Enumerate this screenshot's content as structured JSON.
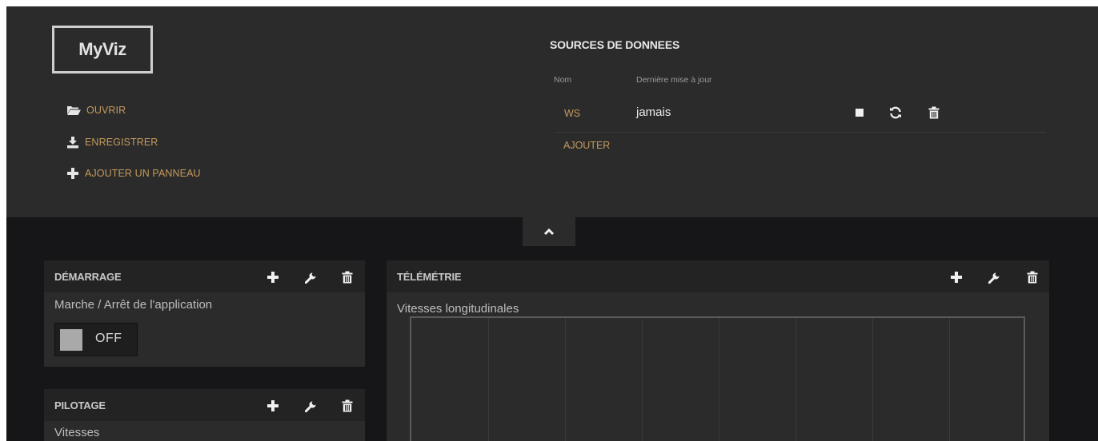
{
  "app": {
    "logo": "MyViz"
  },
  "menu": {
    "open": "OUVRIR",
    "save": "ENREGISTRER",
    "add_panel": "AJOUTER UN PANNEAU"
  },
  "datasources": {
    "title": "SOURCES DE DONNEES",
    "col_name": "Nom",
    "col_update": "Dernière mise à jour",
    "rows": [
      {
        "name": "WS",
        "last_update": "jamais"
      }
    ],
    "add_label": "AJOUTER"
  },
  "panels": {
    "demarrage": {
      "title": "DÉMARRAGE",
      "widget_title": "Marche / Arrêt de l'application",
      "switch_label": "OFF"
    },
    "pilotage": {
      "title": "PILOTAGE",
      "widget_title": "Vitesses"
    },
    "telemetrie": {
      "title": "TÉLÉMÉTRIE",
      "widget_title": "Vitesses longitudinales"
    }
  },
  "colors": {
    "accent": "#c59a5c",
    "header_bg": "#2b2b2b",
    "page_bg": "#161618",
    "panel_bg": "#2b2b2b"
  },
  "icons": {
    "open": "folder-open-icon",
    "save": "download-icon",
    "add_panel": "plus-icon",
    "stop": "stop-icon",
    "refresh": "refresh-icon",
    "delete": "trash-icon",
    "collapse": "chevron-up-icon",
    "settings": "wrench-icon"
  }
}
